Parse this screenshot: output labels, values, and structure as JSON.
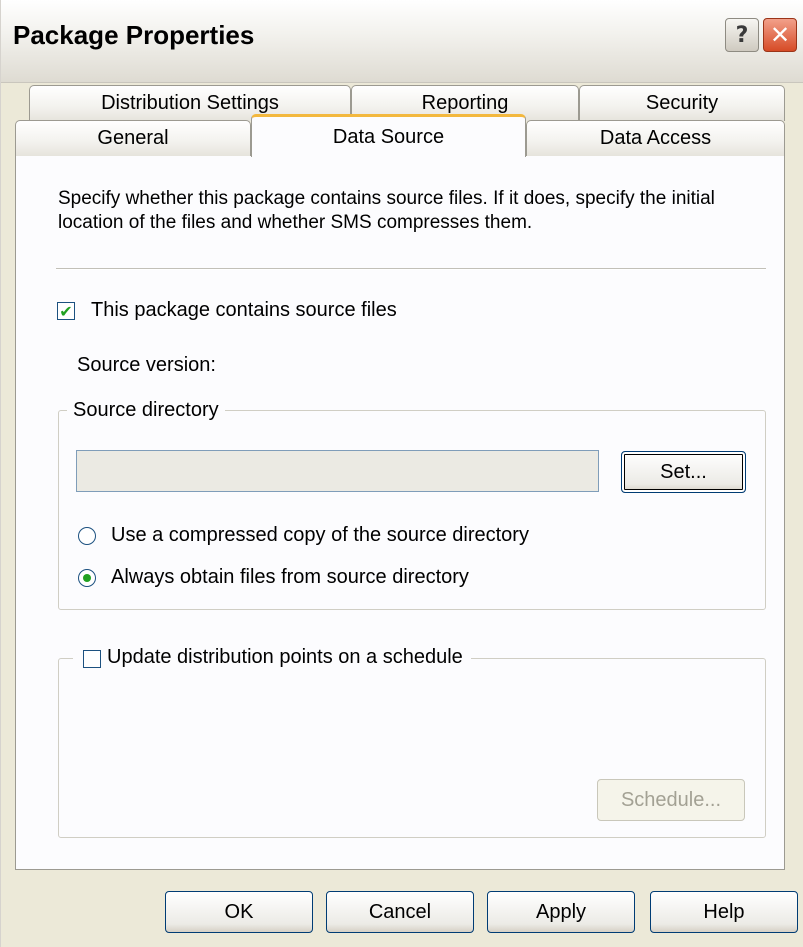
{
  "window": {
    "title": "Package Properties",
    "help_glyph": "?",
    "close_glyph": "✕"
  },
  "tabs": {
    "row1": [
      "Distribution Settings",
      "Reporting",
      "Security"
    ],
    "row2": [
      "General",
      "Data Source",
      "Data Access"
    ],
    "active": "Data Source"
  },
  "content": {
    "description": "Specify whether this package contains source files.  If it does, specify the initial location of the files and whether SMS compresses them.",
    "contains_source_checkbox": {
      "label": "This package contains source files",
      "checked": true
    },
    "source_version_label": "Source version:",
    "source_directory": {
      "group_label": "Source directory",
      "value": "",
      "set_button": "Set..."
    },
    "radio_compressed": {
      "label": "Use a compressed copy of the source directory",
      "selected": false
    },
    "radio_always": {
      "label": "Always obtain files from source directory",
      "selected": true
    },
    "update_schedule": {
      "label": "Update distribution points on a schedule",
      "checked": false,
      "schedule_button": "Schedule..."
    }
  },
  "footer": {
    "ok": "OK",
    "cancel": "Cancel",
    "apply": "Apply",
    "help": "Help"
  },
  "icons": {
    "check": "✔"
  }
}
